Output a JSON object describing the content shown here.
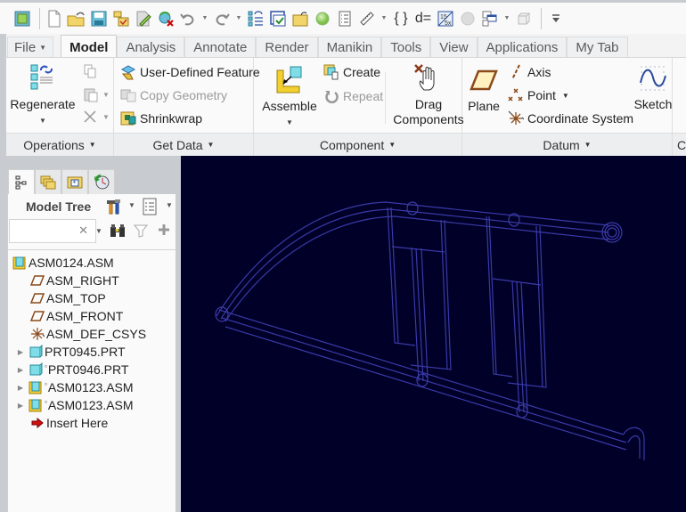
{
  "quick_access_toolbar": {
    "items": [
      {
        "name": "window-icon"
      },
      {
        "name": "new-file-icon"
      },
      {
        "name": "open-file-icon"
      },
      {
        "name": "save-icon"
      },
      {
        "name": "regenerate-flag-icon"
      },
      {
        "name": "edit-pencil-icon"
      },
      {
        "name": "close-window-icon"
      },
      {
        "name": "undo-icon"
      },
      {
        "name": "redo-icon"
      },
      {
        "name": "regenerate-list-icon"
      },
      {
        "name": "window-select-icon"
      },
      {
        "name": "open-folder-icon"
      },
      {
        "name": "status-sphere-icon"
      },
      {
        "name": "list-doc-icon"
      },
      {
        "name": "measure-ruler-icon"
      },
      {
        "name": "braces-icon",
        "text": "{ }"
      },
      {
        "name": "relations-icon",
        "text": "d="
      },
      {
        "name": "parameters-icon"
      },
      {
        "name": "gray-sphere-icon"
      },
      {
        "name": "windows-icon"
      },
      {
        "name": "box-icon"
      },
      {
        "name": "customize-icon"
      }
    ]
  },
  "ribbon": {
    "tabs": [
      {
        "label": "File",
        "has_caret": true
      },
      {
        "label": "Model",
        "active": true
      },
      {
        "label": "Analysis"
      },
      {
        "label": "Annotate"
      },
      {
        "label": "Render"
      },
      {
        "label": "Manikin"
      },
      {
        "label": "Tools"
      },
      {
        "label": "View"
      },
      {
        "label": "Applications"
      },
      {
        "label": "My Tab"
      }
    ],
    "groups": {
      "operations": {
        "label": "Operations",
        "regenerate": "Regenerate"
      },
      "get_data": {
        "label": "Get Data",
        "user_defined_feature": "User-Defined Feature",
        "copy_geometry": "Copy Geometry",
        "shrinkwrap": "Shrinkwrap"
      },
      "component": {
        "label": "Component",
        "assemble": "Assemble",
        "create": "Create",
        "repeat": "Repeat",
        "drag_line1": "Drag",
        "drag_line2": "Components"
      },
      "datum": {
        "label": "Datum",
        "plane": "Plane",
        "axis": "Axis",
        "point": "Point",
        "coordinate_system": "Coordinate System",
        "sketch": "Sketch"
      },
      "next_group_label_partial": "C"
    }
  },
  "left_panel": {
    "tabs": [
      {
        "name": "model-tree-tab",
        "active": true
      },
      {
        "name": "folder-browser-tab"
      },
      {
        "name": "favorites-tab"
      },
      {
        "name": "history-tab"
      }
    ],
    "model_tree_title": "Model Tree",
    "search": {
      "value": "",
      "placeholder": ""
    },
    "tree": [
      {
        "label": "ASM0124.ASM",
        "icon": "assembly",
        "expandable": false,
        "indent": 0
      },
      {
        "label": "ASM_RIGHT",
        "icon": "datum-plane",
        "expandable": false,
        "indent": 1
      },
      {
        "label": "ASM_TOP",
        "icon": "datum-plane",
        "expandable": false,
        "indent": 1
      },
      {
        "label": "ASM_FRONT",
        "icon": "datum-plane",
        "expandable": false,
        "indent": 1
      },
      {
        "label": "ASM_DEF_CSYS",
        "icon": "csys",
        "expandable": false,
        "indent": 1
      },
      {
        "label": "PRT0945.PRT",
        "icon": "part",
        "expandable": true,
        "indent": 1,
        "marker": false
      },
      {
        "label": "PRT0946.PRT",
        "icon": "part",
        "expandable": true,
        "indent": 1,
        "marker": true
      },
      {
        "label": "ASM0123.ASM",
        "icon": "assembly",
        "expandable": true,
        "indent": 1,
        "marker": true
      },
      {
        "label": "ASM0123.ASM",
        "icon": "assembly",
        "expandable": true,
        "indent": 1,
        "marker": true
      },
      {
        "label": "Insert Here",
        "icon": "insert-arrow",
        "expandable": false,
        "indent": 1
      }
    ]
  },
  "graphics": {
    "background": "#000028",
    "wire_color": "#3a3aa8"
  }
}
